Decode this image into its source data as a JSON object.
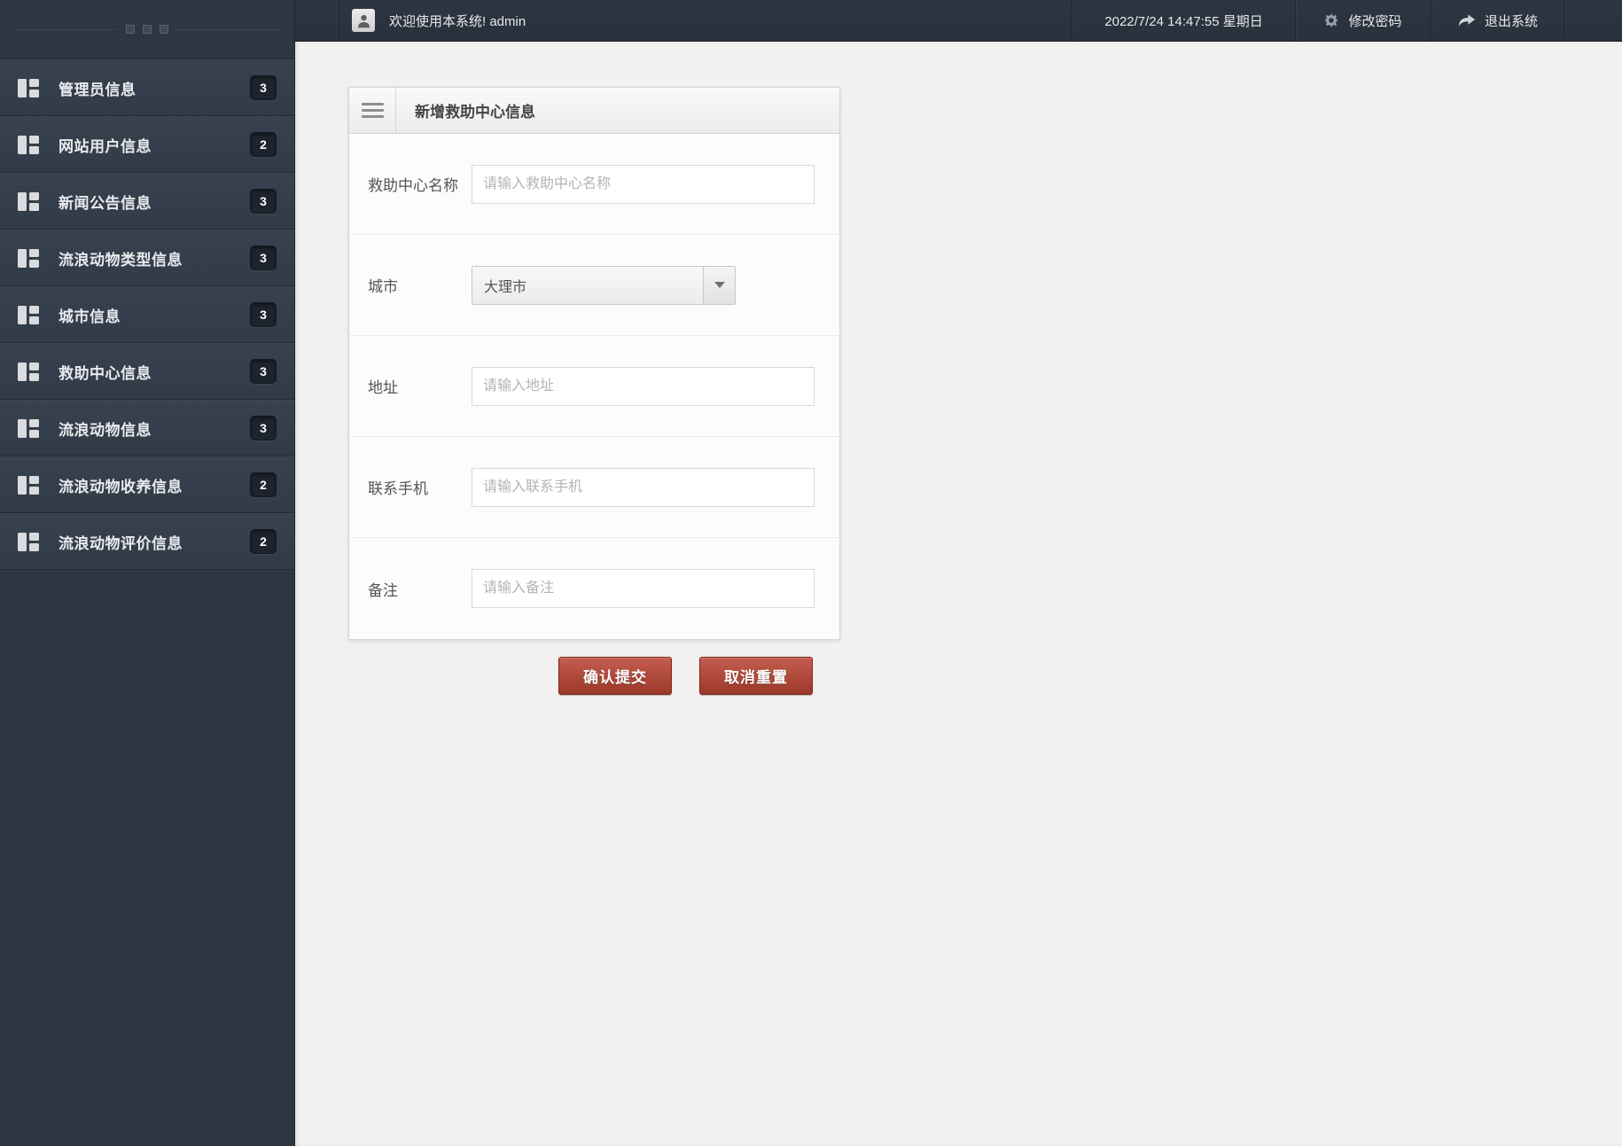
{
  "topbar": {
    "welcome": "欢迎使用本系统! admin",
    "datetime": "2022/7/24 14:47:55 星期日",
    "change_password": "修改密码",
    "logout": "退出系统"
  },
  "sidebar": {
    "items": [
      {
        "label": "管理员信息",
        "badge": "3"
      },
      {
        "label": "网站用户信息",
        "badge": "2"
      },
      {
        "label": "新闻公告信息",
        "badge": "3"
      },
      {
        "label": "流浪动物类型信息",
        "badge": "3"
      },
      {
        "label": "城市信息",
        "badge": "3"
      },
      {
        "label": "救助中心信息",
        "badge": "3"
      },
      {
        "label": "流浪动物信息",
        "badge": "3"
      },
      {
        "label": "流浪动物收养信息",
        "badge": "2"
      },
      {
        "label": "流浪动物评价信息",
        "badge": "2"
      }
    ]
  },
  "form": {
    "title": "新增救助中心信息",
    "fields": [
      {
        "label": "救助中心名称",
        "type": "text",
        "placeholder": "请输入救助中心名称",
        "value": ""
      },
      {
        "label": "城市",
        "type": "select",
        "value": "大理市"
      },
      {
        "label": "地址",
        "type": "text",
        "placeholder": "请输入地址",
        "value": ""
      },
      {
        "label": "联系手机",
        "type": "text",
        "placeholder": "请输入联系手机",
        "value": ""
      },
      {
        "label": "备注",
        "type": "text",
        "placeholder": "请输入备注",
        "value": ""
      }
    ],
    "submit_label": "确认提交",
    "reset_label": "取消重置"
  },
  "colors": {
    "sidebar_bg": "#2d3642",
    "topbar_bg": "#2a323e",
    "accent_red": "#a33a2b",
    "main_bg": "#f2f1ef"
  }
}
